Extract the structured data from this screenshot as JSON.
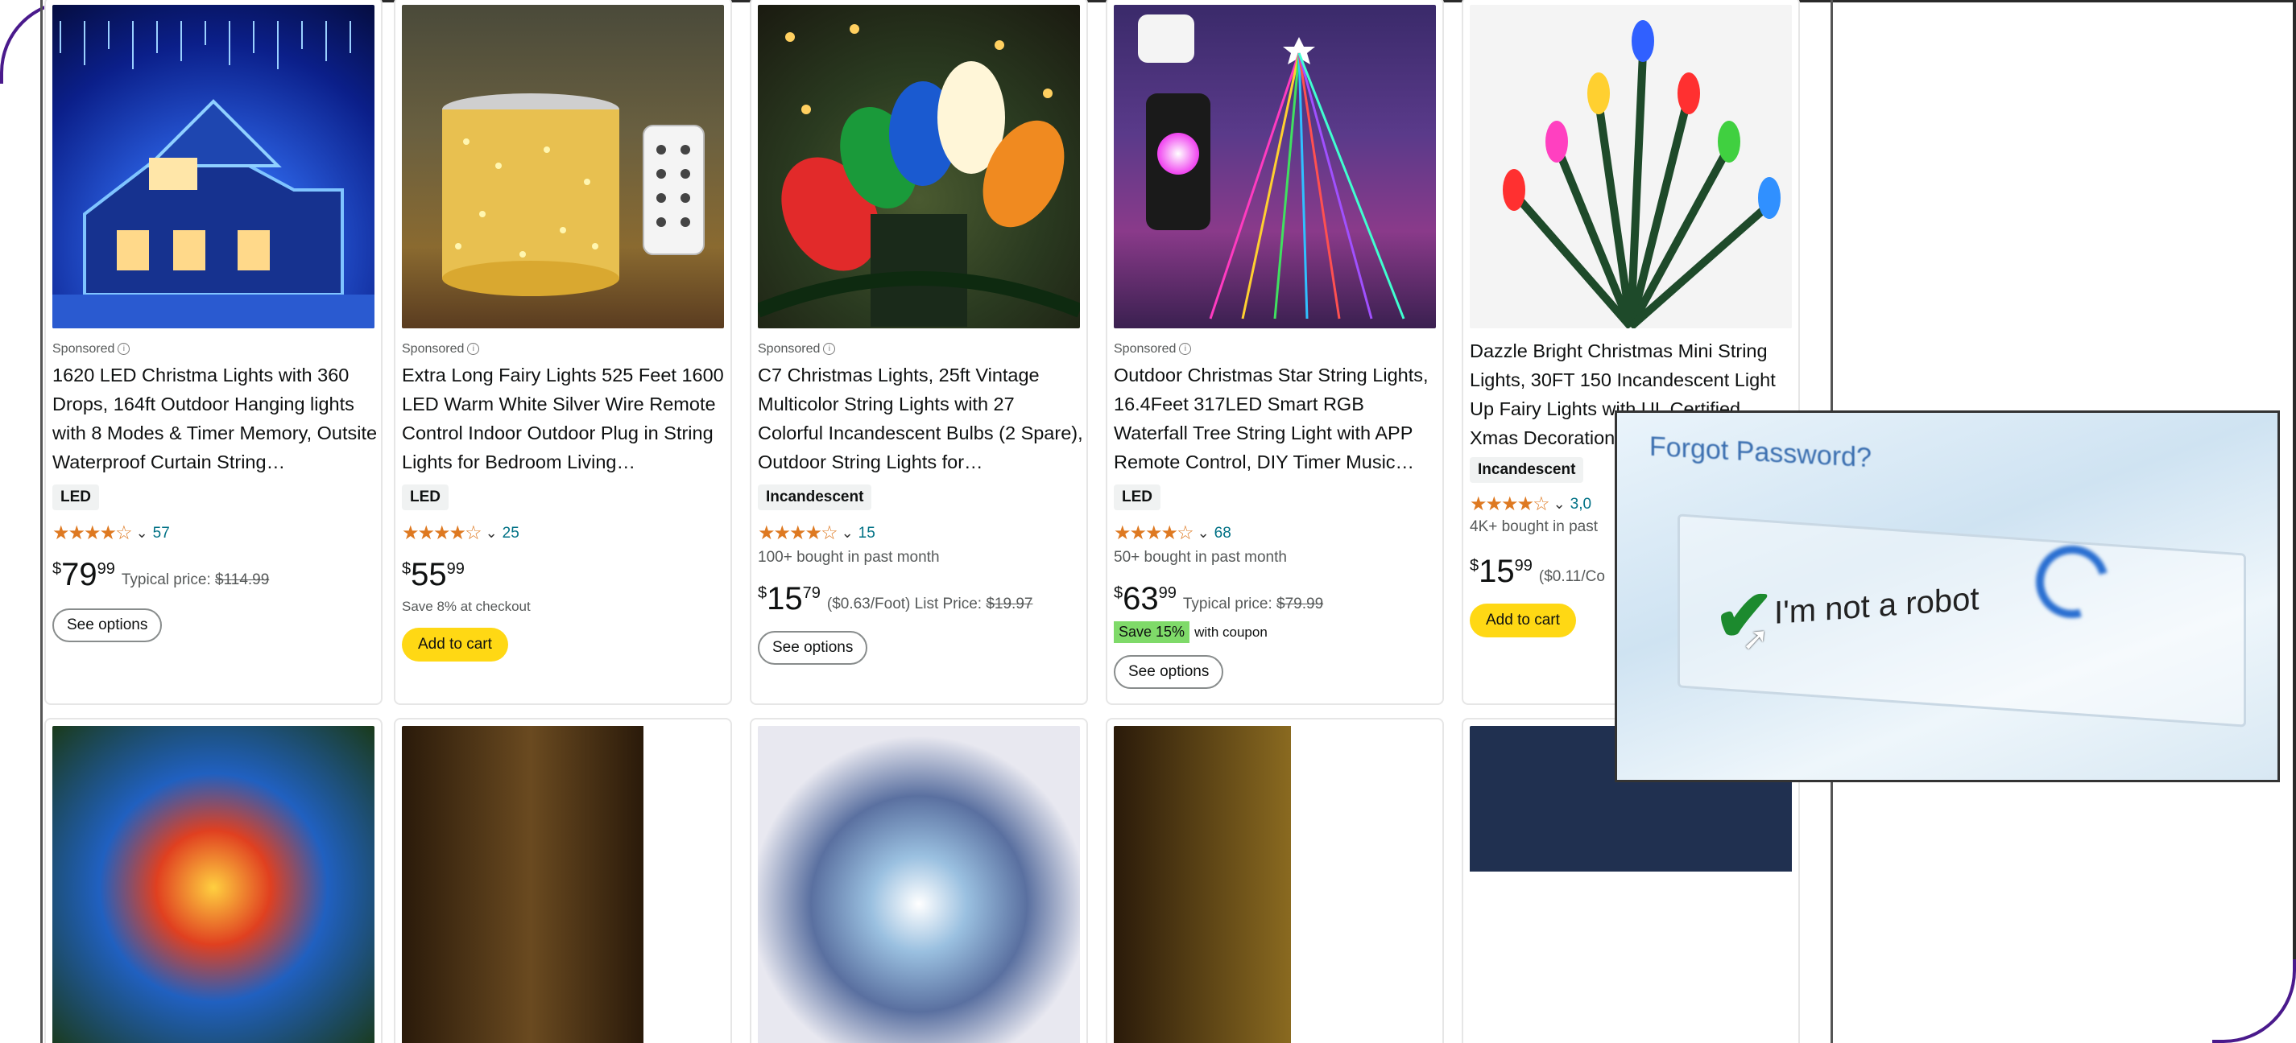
{
  "products_row1": [
    {
      "sponsored": "Sponsored",
      "title": "1620 LED Christma Lights with 360 Drops, 164ft Outdoor Hanging lights with 8 Modes & Timer Memory, Outsite Waterproof Curtain String…",
      "badge": "LED",
      "stars": "★★★★☆",
      "rating_count": "57",
      "price_cur": "$",
      "price_whole": "79",
      "price_frac": "99",
      "price_extra_label": "Typical price: ",
      "price_extra_strike": "$114.99",
      "button": "See options"
    },
    {
      "sponsored": "Sponsored",
      "title": "Extra Long Fairy Lights 525 Feet 1600 LED Warm White Silver Wire Remote Control Indoor Outdoor Plug in String Lights for Bedroom Living…",
      "badge": "LED",
      "stars": "★★★★☆",
      "rating_count": "25",
      "price_cur": "$",
      "price_whole": "55",
      "price_frac": "99",
      "note": "Save 8% at checkout",
      "button": "Add to cart"
    },
    {
      "sponsored": "Sponsored",
      "title": "C7 Christmas Lights, 25ft Vintage Multicolor String Lights with 27 Colorful Incandescent Bulbs (2 Spare), Outdoor String Lights for…",
      "badge": "Incandescent",
      "stars": "★★★★☆",
      "rating_count": "15",
      "bought": "100+ bought in past month",
      "price_cur": "$",
      "price_whole": "15",
      "price_frac": "79",
      "price_extra_label": "($0.63/Foot) List Price: ",
      "price_extra_strike": "$19.97",
      "button": "See options"
    },
    {
      "sponsored": "Sponsored",
      "title": "Outdoor Christmas Star String Lights, 16.4Feet 317LED Smart RGB Waterfall Tree String Light with APP Remote Control, DIY Timer Music…",
      "badge": "LED",
      "stars": "★★★★☆",
      "rating_count": "68",
      "bought": "50+ bought in past month",
      "price_cur": "$",
      "price_whole": "63",
      "price_frac": "99",
      "price_extra_label": "Typical price: ",
      "price_extra_strike": "$79.99",
      "save_badge": "Save 15%",
      "save_text": "with coupon",
      "button": "See options"
    },
    {
      "title": "Dazzle Bright Christmas Mini String Lights, 30FT 150 Incandescent Light Up Fairy Lights with UL Certified, Xmas Decoration…",
      "badge": "Incandescent",
      "stars": "★★★★☆",
      "rating_count": "3,0",
      "bought": "4K+ bought in past",
      "price_cur": "$",
      "price_whole": "15",
      "price_frac": "99",
      "price_extra_label": "($0.11/Co",
      "button": "Add to cart"
    }
  ],
  "captcha": {
    "heading": "Forgot Password?",
    "label": "I'm not a robot"
  },
  "colors": {
    "star": "#de7921",
    "link": "#007185",
    "add_to_cart": "#ffd814",
    "coupon_green": "#7fda69",
    "frame_purple": "#4a1a8c"
  }
}
